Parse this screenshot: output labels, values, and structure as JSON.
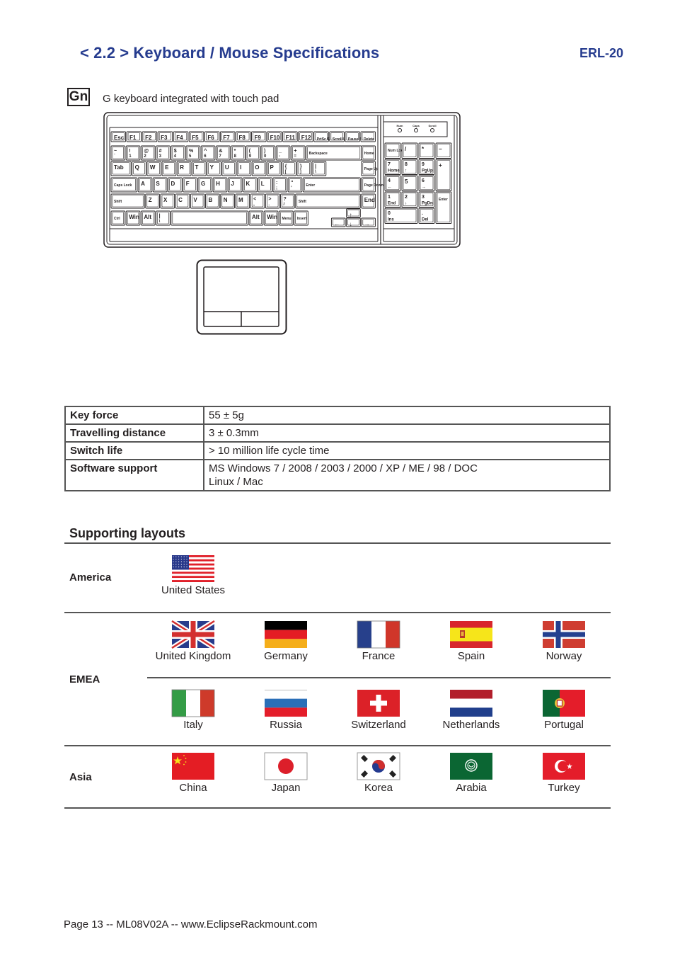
{
  "header": {
    "title": "< 2.2 > Keyboard  /  Mouse Specifications",
    "model": "ERL-20"
  },
  "option": {
    "code": "Gn",
    "description": "G keyboard integrated with touch pad"
  },
  "keyboard": {
    "leds": [
      "Num",
      "Caps",
      "Scroll"
    ],
    "rows": [
      [
        "Esc",
        "F1",
        "F2",
        "F3",
        "F4",
        "F5",
        "F6",
        "F7",
        "F8",
        "F9",
        "F10",
        "F11",
        "F12",
        "PrtSc SysRq",
        "Scroll Lock",
        "Pause Break",
        "Delete"
      ],
      [
        "~ `",
        "! 1",
        "@ 2",
        "# 3",
        "$ 4",
        "% 5",
        "^ 6",
        "& 7",
        "* 8",
        "( 9",
        ") 0",
        "_ -",
        "+ =",
        "Backspace",
        "Home"
      ],
      [
        "Tab",
        "Q",
        "W",
        "E",
        "R",
        "T",
        "Y",
        "U",
        "I",
        "O",
        "P",
        "{ [",
        "} ]",
        "| \\",
        "Page Up"
      ],
      [
        "Caps Lock",
        "A",
        "S",
        "D",
        "F",
        "G",
        "H",
        "J",
        "K",
        "L",
        ": ;",
        "\" '",
        "Enter",
        "Page Down"
      ],
      [
        "Shift",
        "Z",
        "X",
        "C",
        "V",
        "B",
        "N",
        "M",
        "< ,",
        "> .",
        "? /",
        "Shift",
        "End"
      ],
      [
        "Ctrl",
        "Win",
        "Alt",
        "| \\",
        "",
        "Alt",
        "Win",
        "Menu",
        "Insert",
        "↑",
        "←",
        "↓",
        "→"
      ]
    ],
    "numpad": [
      [
        "Num Lock",
        "/",
        "*",
        "−"
      ],
      [
        "7 Home",
        "8 ↑",
        "9 PgUp",
        "+"
      ],
      [
        "4 ←",
        "5",
        "6 →"
      ],
      [
        "1 End",
        "2 ↓",
        "3 PgDn",
        "Enter"
      ],
      [
        "0 Ins",
        ". Del"
      ]
    ]
  },
  "specs": [
    {
      "label": "Key force",
      "value": "55 ± 5g"
    },
    {
      "label": "Travelling distance",
      "value": "3 ± 0.3mm"
    },
    {
      "label": "Switch life",
      "value": "> 10 million life cycle time"
    },
    {
      "label": "Software support",
      "value": "MS Windows 7 / 2008 / 2003 / 2000 / XP / ME / 98 / DOC",
      "value2": "Linux / Mac"
    }
  ],
  "layouts": {
    "title": "Supporting layouts",
    "regions": [
      {
        "name": "America",
        "countries": [
          {
            "name": "United States",
            "flag": "us-flag"
          }
        ]
      },
      {
        "name": "EMEA",
        "countries": [
          {
            "name": "United Kingdom",
            "flag": "uk-flag"
          },
          {
            "name": "Germany",
            "flag": "germany-flag"
          },
          {
            "name": "France",
            "flag": "france-flag"
          },
          {
            "name": "Spain",
            "flag": "spain-flag"
          },
          {
            "name": "Norway",
            "flag": "norway-flag"
          },
          {
            "name": "Italy",
            "flag": "italy-flag"
          },
          {
            "name": "Russia",
            "flag": "russia-flag"
          },
          {
            "name": "Switzerland",
            "flag": "switzerland-flag"
          },
          {
            "name": "Netherlands",
            "flag": "netherlands-flag"
          },
          {
            "name": "Portugal",
            "flag": "portugal-flag"
          }
        ]
      },
      {
        "name": "Asia",
        "countries": [
          {
            "name": "China",
            "flag": "china-flag"
          },
          {
            "name": "Japan",
            "flag": "japan-flag"
          },
          {
            "name": "Korea",
            "flag": "korea-flag"
          },
          {
            "name": "Arabia",
            "flag": "arabia-flag"
          },
          {
            "name": "Turkey",
            "flag": "turkey-flag"
          }
        ]
      }
    ]
  },
  "colors": {
    "title_blue": "#263c8f"
  },
  "footer": {
    "text": "Page 13 -- ML08V02A -- www.EclipseRackmount.com"
  }
}
